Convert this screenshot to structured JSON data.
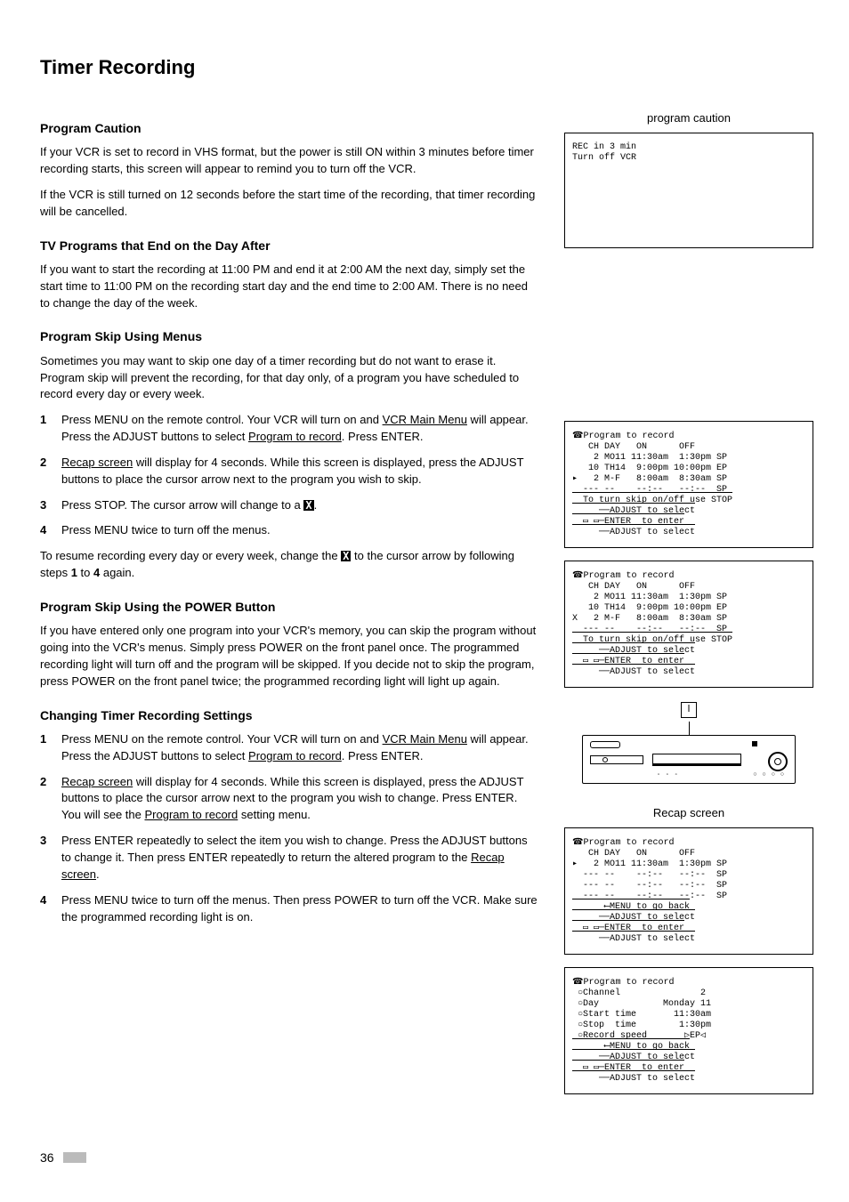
{
  "title": "Timer Recording",
  "h_caution": "Program Caution",
  "p_caution1": "If your VCR is set to record in VHS format, but the power is still ON within 3 minutes before timer recording starts, this screen will appear to remind you to turn off the VCR.",
  "p_caution2": "If the VCR is still turned on 12 seconds before the start time of the recording, that timer recording will be cancelled.",
  "h_dayafter": "TV Programs that End on the Day After",
  "p_dayafter": "If you want to start the recording at 11:00 PM and end it at 2:00 AM the next day, simply set the start time to 11:00 PM on the recording start day and the end time to 2:00 AM.  There is no need to change the day of the week.",
  "h_skipmenus": "Program Skip Using Menus",
  "p_skipintro": "Sometimes you may want to skip one day of a timer recording but do not want to erase it.  Program skip will prevent the recording, for that day only, of a program you have scheduled to record every day or every week.",
  "skip_steps": [
    {
      "n": "1",
      "pre": "Press MENU on the remote control.  Your VCR will turn on and ",
      "u1": "VCR Main Menu",
      "mid": " will appear.  Press the ADJUST buttons to select ",
      "u2": "Program to record",
      "post": ". Press ENTER."
    },
    {
      "n": "2",
      "pre": "",
      "u1": "Recap screen",
      "mid": " will display for 4 seconds.  While this screen is displayed, press the ADJUST buttons to place the cursor arrow next to the program you wish to skip.",
      "u2": "",
      "post": ""
    },
    {
      "n": "3",
      "pre": "Press STOP.  The cursor arrow will change to a ",
      "u1": "",
      "mid": "",
      "u2": "",
      "post": ".",
      "xbox": "X"
    },
    {
      "n": "4",
      "pre": "Press MENU twice to turn off the menus.",
      "u1": "",
      "mid": "",
      "u2": "",
      "post": ""
    }
  ],
  "p_resume_a": "To resume recording every day or every week, change the ",
  "p_resume_b": " to the cursor arrow by following steps ",
  "p_resume_bold1": "1",
  "p_resume_mid": " to ",
  "p_resume_bold4": "4",
  "p_resume_end": " again.",
  "h_skippower": "Program Skip Using the POWER Button",
  "p_skippower": "If you have entered only one program into your VCR's memory, you can skip the program without going into the VCR's menus.  Simply press POWER on the front panel once.  The programmed recording light will turn off and the program will be skipped.  If you decide not to skip the program, press POWER on the front panel twice; the programmed recording light will light up again.",
  "h_change": "Changing Timer Recording Settings",
  "change_steps": [
    {
      "n": "1",
      "pre": "Press MENU on the remote control.  Your VCR will turn on and ",
      "u1": "VCR Main Menu",
      "mid": " will appear.  Press the ADJUST buttons to select ",
      "u2": "Program to record",
      "post": ". Press ENTER."
    },
    {
      "n": "2",
      "pre": "",
      "u1": "Recap screen",
      "mid": " will display for 4 seconds.  While this screen is displayed, press the ADJUST buttons to place the cursor arrow next to the program you wish to change.  Press ENTER.  You will see the ",
      "u2": "Program to record",
      "post": " setting menu."
    },
    {
      "n": "3",
      "pre": "Press ENTER repeatedly to select the item you wish to change.  Press the ADJUST buttons to change it.  Then press ENTER repeatedly to return the altered program to the ",
      "u1": "Recap screen",
      "mid": "",
      "u2": "",
      "post": "."
    },
    {
      "n": "4",
      "pre": "Press MENU twice to turn off the menus.  Then press POWER to turn off the VCR. Make sure the programmed recording light is on.",
      "u1": "",
      "mid": "",
      "u2": "",
      "post": ""
    }
  ],
  "caption_program": "program caution",
  "screen_caution_l1": "REC in 3 min",
  "screen_caution_l2": "Turn off VCR",
  "screen_ptr_title": "Program to record",
  "ptr_hdr": "   CH DAY   ON      OFF",
  "ptr_r1": "    2 MO11 11:30am  1:30pm SP",
  "ptr_r2": "   10 TH14  9:00pm 10:00pm EP",
  "ptr_r3a": "▸   2 M-F   8:00am  8:30am SP",
  "ptr_r3b": "X   2 M-F   8:00am  8:30am SP",
  "ptr_r4": "  --- --    --:--   --:--  SP",
  "ptr_foot1": "  To turn skip on/off use STOP",
  "ptr_foot2": "     ──ADJUST to select",
  "ptr_foot3": "  ▭ ▭─ENTER  to enter",
  "ptr_foot4": "     ──ADJUST to select",
  "caption_recap": "Recap screen",
  "recap_r1": "▸   2 MO11 11:30am  1:30pm SP",
  "recap_r2": "  --- --    --:--   --:--  SP",
  "recap_r3": "  --- --    --:--   --:--  SP",
  "recap_r4": "  --- --    --:--   --:--  SP",
  "recap_foot1": "      ⟵MENU to go back",
  "recap_foot2": "     ──ADJUST to select",
  "recap_foot3": "  ▭ ▭─ENTER  to enter",
  "recap_foot4": "     ──ADJUST to select",
  "set_l1": " ○Channel               2",
  "set_l2": " ○Day            Monday 11",
  "set_l3": " ○Start time       11:30am",
  "set_l4": " ○Stop  time        1:30pm",
  "set_l5": " ○Record speed       ▷EP◁",
  "page_number": "36"
}
